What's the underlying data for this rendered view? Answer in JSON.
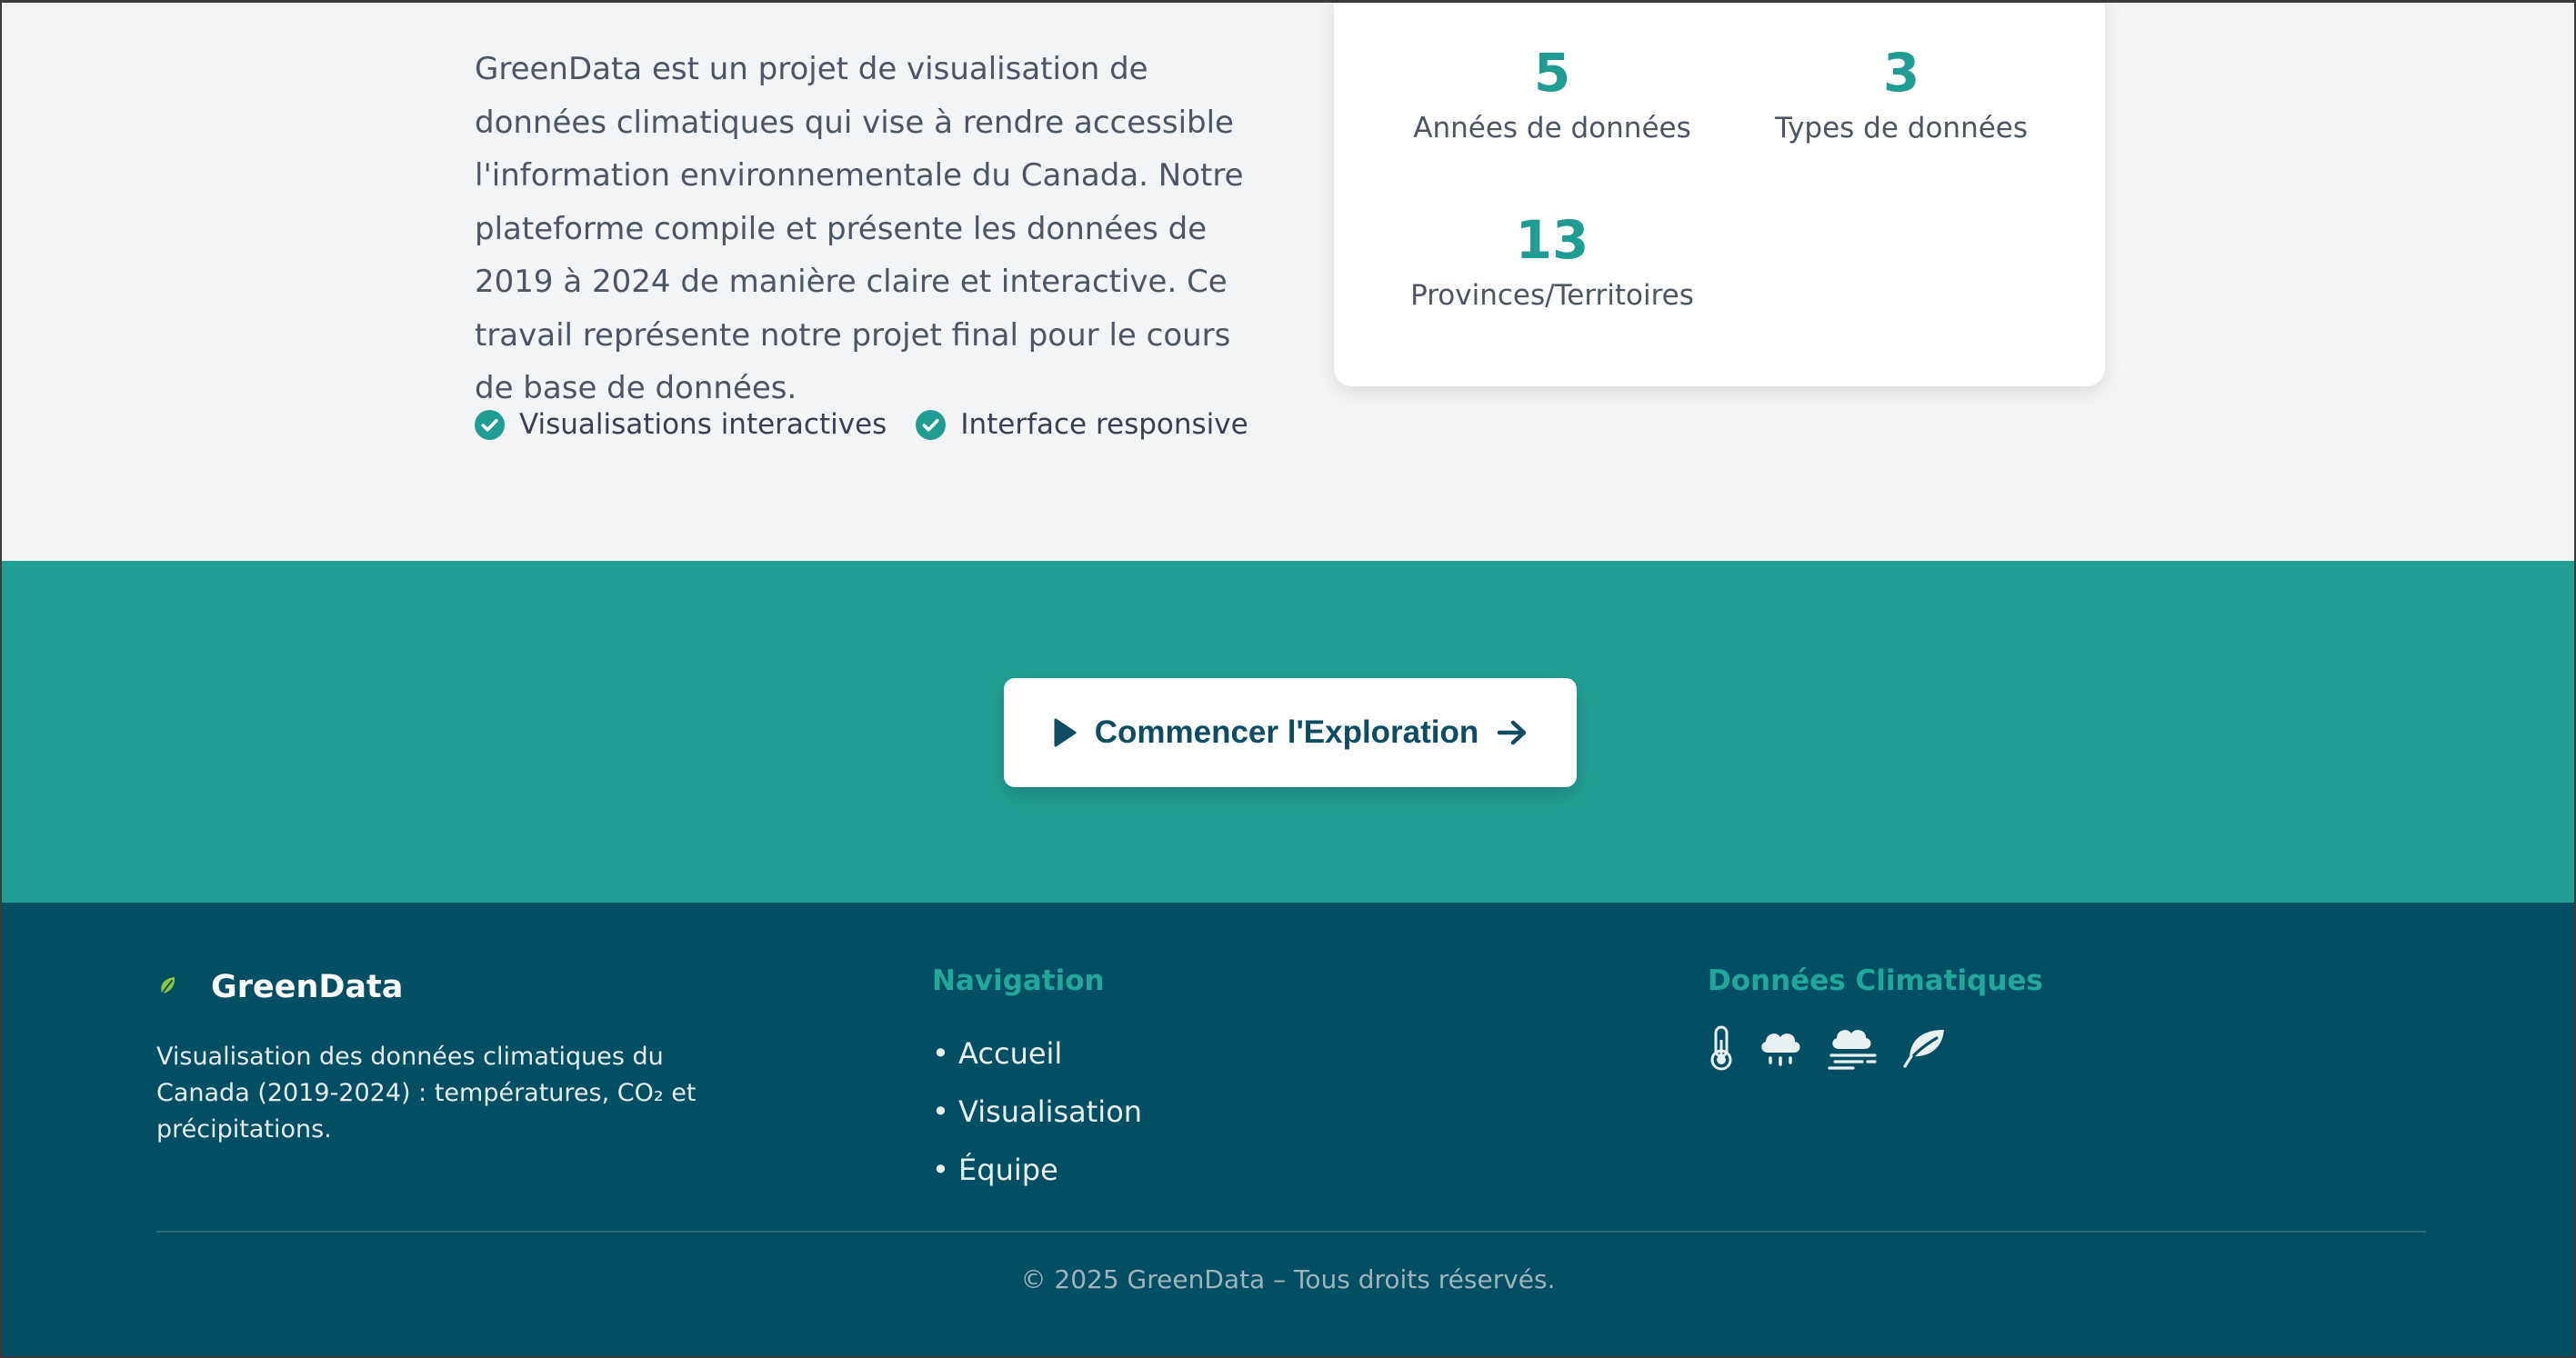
{
  "about": {
    "paragraph": "GreenData est un projet de visualisation de données climatiques qui vise à rendre accessible l'information environnementale du Canada. Notre plateforme compile et présente les données de 2019 à 2024 de manière claire et interactive. Ce travail représente notre projet final pour le cours de base de données.",
    "features": [
      {
        "label": "Visualisations interactives",
        "icon": "check-circle-icon"
      },
      {
        "label": "Interface responsive",
        "icon": "check-circle-icon"
      }
    ]
  },
  "stats": [
    {
      "number": "5",
      "label": "Années de données"
    },
    {
      "number": "3",
      "label": "Types de données"
    },
    {
      "number": "13",
      "label": "Provinces/Territoires"
    }
  ],
  "cta": {
    "label": "Commencer l'Exploration",
    "icon_left": "play-icon",
    "icon_right": "arrow-right-icon"
  },
  "footer": {
    "brand": "GreenData",
    "brand_icon": "leaf-icon",
    "description": "Visualisation des données climatiques du Canada (2019-2024) : températures, CO₂ et précipitations.",
    "nav_heading": "Navigation",
    "nav_items": [
      "• Accueil",
      "• Visualisation",
      "• Équipe"
    ],
    "data_heading": "Données Climatiques",
    "data_icons": [
      "thermometer-icon",
      "rain-cloud-icon",
      "fog-cloud-icon",
      "leaf-icon"
    ],
    "copyright": "© 2025 GreenData – Tous droits réservés."
  },
  "colors": {
    "accent": "#1f9d93",
    "cta_band": "#219f94",
    "footer_bg": "#024f64",
    "page_bg": "#f3f4f6",
    "button_text": "#0d4d63"
  }
}
